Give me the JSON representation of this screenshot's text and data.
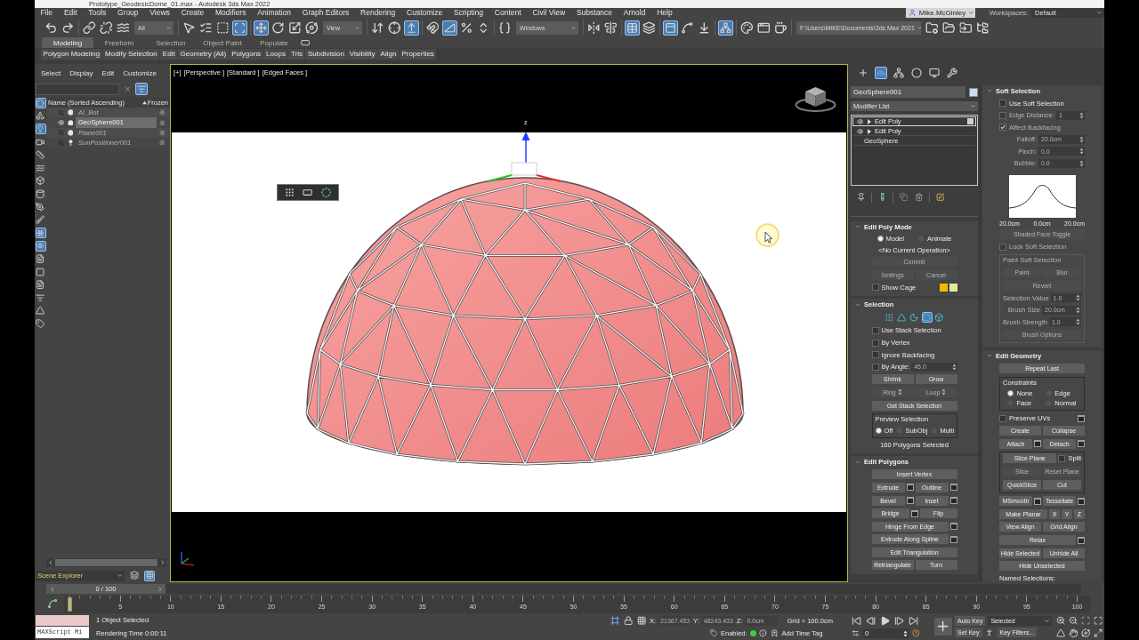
{
  "window": {
    "title": "Prototype_GeodesicDome_01.max - Autodesk 3ds Max 2022"
  },
  "menu": [
    "File",
    "Edit",
    "Tools",
    "Group",
    "Views",
    "Create",
    "Modifiers",
    "Animation",
    "Graph Editors",
    "Rendering",
    "Customize",
    "Scripting",
    "Content",
    "Civil View",
    "Substance",
    "Arnold",
    "Help"
  ],
  "user": {
    "name": "Mike.McGinley"
  },
  "workspaces": {
    "label": "Workspaces:",
    "value": "Default"
  },
  "main_toolbar": [
    {
      "items": [
        {
          "kind": "icon",
          "on": false
        },
        {
          "kind": "icon",
          "on": false
        }
      ]
    },
    {
      "items": [
        {
          "kind": "icon",
          "on": false
        },
        {
          "kind": "icon",
          "on": false
        },
        {
          "kind": "icon",
          "on": false
        },
        {
          "kind": "dropdown",
          "value": "All"
        }
      ]
    },
    {
      "items": [
        {
          "kind": "icon",
          "on": false
        },
        {
          "kind": "icon",
          "on": false
        },
        {
          "kind": "icon",
          "on": false
        },
        {
          "kind": "icon",
          "on": true
        }
      ]
    },
    {
      "items": [
        {
          "kind": "icon",
          "on": true
        },
        {
          "kind": "icon",
          "on": false
        },
        {
          "kind": "icon",
          "on": false
        },
        {
          "kind": "icon",
          "on": false
        },
        {
          "kind": "dropdown",
          "value": "View"
        }
      ]
    },
    {
      "items": [
        {
          "kind": "icon",
          "on": false
        },
        {
          "kind": "icon",
          "on": false
        },
        {
          "kind": "icon",
          "on": true
        }
      ]
    },
    {
      "items": [
        {
          "kind": "icon",
          "on": false
        },
        {
          "kind": "icon",
          "on": true
        },
        {
          "kind": "icon",
          "on": false
        },
        {
          "kind": "icon",
          "on": false
        }
      ]
    },
    {
      "items": [
        {
          "kind": "icon",
          "on": false
        },
        {
          "kind": "dropdown",
          "value": "Windows"
        }
      ]
    },
    {
      "items": [
        {
          "kind": "icon",
          "on": false
        },
        {
          "kind": "icon",
          "on": false
        }
      ]
    },
    {
      "items": [
        {
          "kind": "icon",
          "on": true
        },
        {
          "kind": "icon",
          "on": false
        }
      ]
    },
    {
      "items": [
        {
          "kind": "icon",
          "on": true
        },
        {
          "kind": "icon",
          "on": false
        },
        {
          "kind": "icon",
          "on": false
        }
      ]
    },
    {
      "items": [
        {
          "kind": "icon",
          "on": true
        }
      ]
    },
    {
      "items": [
        {
          "kind": "icon",
          "on": false
        },
        {
          "kind": "icon",
          "on": false
        },
        {
          "kind": "icon",
          "on": false
        }
      ]
    },
    {
      "items": [
        {
          "kind": "dropdown",
          "value": "F:\\Users\\MIKE\\Documents\\3ds Max 2021"
        },
        {
          "kind": "icon",
          "on": false
        },
        {
          "kind": "icon",
          "on": false
        },
        {
          "kind": "icon",
          "on": false
        },
        {
          "kind": "icon",
          "on": false
        }
      ]
    }
  ],
  "ribbon": {
    "tabs": [
      {
        "label": "Modeling",
        "selected": true
      },
      {
        "label": "Freeform",
        "selected": false
      },
      {
        "label": "Selection",
        "selected": false
      },
      {
        "label": "Object Paint",
        "selected": false
      },
      {
        "label": "Populate",
        "selected": false
      }
    ],
    "panels": [
      "Polygon Modeling",
      "Modify Selection",
      "Edit",
      "Geometry (All)",
      "Polygons",
      "Loops",
      "Tris",
      "Subdivision",
      "Visibility",
      "Align",
      "Properties"
    ]
  },
  "scene_explorer": {
    "menu": [
      "Select",
      "Display",
      "Edit",
      "Customize"
    ],
    "filter_on": true,
    "filters": [
      {
        "on": true
      },
      {
        "on": false
      },
      {
        "on": true
      },
      {
        "on": false
      },
      {
        "on": false
      },
      {
        "on": false
      },
      {
        "on": false
      },
      {
        "on": false
      },
      {
        "on": false
      },
      {
        "on": false
      },
      {
        "on": true
      },
      {
        "on": true
      },
      {
        "on": false
      },
      {
        "on": false
      },
      {
        "on": false
      },
      {
        "on": false
      },
      {
        "on": false
      },
      {
        "on": false
      }
    ],
    "columns": [
      "Name (Sorted Ascending)",
      "Frozen"
    ],
    "rows": [
      {
        "name": "AI_Bot",
        "kind": "geometry",
        "hidden": true,
        "selected": false
      },
      {
        "name": "GeoSphere001",
        "kind": "geometry",
        "hidden": false,
        "selected": true
      },
      {
        "name": "Plane001",
        "kind": "geometry",
        "hidden": true,
        "selected": false
      },
      {
        "name": "SunPositioner001",
        "kind": "light",
        "hidden": true,
        "selected": false
      }
    ],
    "footer": {
      "label": "Scene Explorer",
      "toggles": [
        {
          "on": false
        },
        {
          "on": true
        }
      ]
    }
  },
  "viewport": {
    "labels": [
      "[+]",
      "[Perspective ]",
      "[Standard ]",
      "[Edged Faces ]"
    ],
    "gizmo_label": "z"
  },
  "command_panel": {
    "tabs": [
      {
        "selected": false
      },
      {
        "selected": true
      },
      {
        "selected": false
      },
      {
        "selected": false
      },
      {
        "selected": false
      },
      {
        "selected": false
      }
    ],
    "object_name": "GeoSphere001",
    "modifier_list": "Modifier List",
    "stack": [
      {
        "name": "Edit Poly",
        "kind": "modifier",
        "expanded": false,
        "selected": true
      },
      {
        "name": "Edit Poly",
        "kind": "modifier",
        "expanded": false,
        "selected": false
      },
      {
        "name": "GeoSphere",
        "kind": "base",
        "expanded": false,
        "selected": false
      }
    ],
    "left_rollouts": [
      {
        "title": "Edit Poly Mode",
        "expanded": true,
        "items": [
          {
            "kind": "radios",
            "options": [
              {
                "label": "Model",
                "selected": true
              },
              {
                "label": "Animate",
                "selected": false
              }
            ]
          },
          {
            "kind": "text",
            "text": "<No Current Operation>"
          },
          {
            "kind": "row",
            "items": [
              {
                "kind": "button",
                "label": "Commit",
                "disabled": true
              }
            ]
          },
          {
            "kind": "row",
            "items": [
              {
                "kind": "button",
                "label": "Settings",
                "disabled": true
              },
              {
                "kind": "button",
                "label": "Cancel",
                "disabled": true
              }
            ]
          },
          {
            "kind": "row",
            "items": [
              {
                "kind": "checkbox",
                "label": "Show Cage",
                "checked": false,
                "disabled": false
              },
              {
                "kind": "swatch",
                "color": "#f5b800"
              },
              {
                "kind": "swatch",
                "color": "#e3eaa0"
              }
            ]
          }
        ]
      },
      {
        "title": "Selection",
        "expanded": true,
        "items": [
          {
            "kind": "icons",
            "options": [
              {
                "selected": false
              },
              {
                "selected": false
              },
              {
                "selected": false
              },
              {
                "selected": true
              },
              {
                "selected": false
              }
            ]
          },
          {
            "kind": "row",
            "items": [
              {
                "kind": "checkbox",
                "label": "Use Stack Selection",
                "checked": false,
                "disabled": false
              }
            ]
          },
          {
            "kind": "row",
            "items": [
              {
                "kind": "checkbox",
                "label": "By Vertex",
                "checked": false,
                "disabled": false
              }
            ]
          },
          {
            "kind": "row",
            "items": [
              {
                "kind": "checkbox",
                "label": "Ignore Backfacing",
                "checked": false,
                "disabled": false
              }
            ]
          },
          {
            "kind": "row",
            "items": [
              {
                "kind": "checkbox",
                "label": "By Angle:",
                "checked": false,
                "disabled": false
              },
              {
                "kind": "spinner",
                "value": "45.0",
                "disabled": true
              }
            ]
          },
          {
            "kind": "row",
            "items": [
              {
                "kind": "button",
                "label": "Shrink",
                "disabled": false
              },
              {
                "kind": "button",
                "label": "Grow",
                "disabled": false
              }
            ]
          },
          {
            "kind": "row",
            "items": [
              {
                "kind": "spin_button",
                "label": "Ring",
                "disabled": true
              },
              {
                "kind": "spin_button",
                "label": "Loop",
                "disabled": true
              }
            ]
          },
          {
            "kind": "row",
            "items": [
              {
                "kind": "button",
                "label": "Get Stack Selection",
                "disabled": false
              }
            ]
          },
          {
            "kind": "group",
            "title": "Preview Selection",
            "disabled": false,
            "items": [
              {
                "kind": "radios",
                "options": [
                  {
                    "label": "Off",
                    "selected": true
                  },
                  {
                    "label": "SubObj",
                    "selected": false
                  },
                  {
                    "label": "Multi",
                    "selected": false
                  }
                ]
              }
            ]
          },
          {
            "kind": "text",
            "text": "160 Polygons Selected"
          }
        ]
      },
      {
        "title": "Edit Polygons",
        "expanded": true,
        "items": [
          {
            "kind": "row",
            "items": [
              {
                "kind": "button",
                "label": "Insert Vertex",
                "disabled": false
              }
            ]
          },
          {
            "kind": "row",
            "items": [
              {
                "kind": "button",
                "label": "Extrude",
                "disabled": false
              },
              {
                "kind": "settings"
              },
              {
                "kind": "button",
                "label": "Outline",
                "disabled": false
              },
              {
                "kind": "settings"
              }
            ]
          },
          {
            "kind": "row",
            "items": [
              {
                "kind": "button",
                "label": "Bevel",
                "disabled": false
              },
              {
                "kind": "settings"
              },
              {
                "kind": "button",
                "label": "Inset",
                "disabled": false
              },
              {
                "kind": "settings"
              }
            ]
          },
          {
            "kind": "row",
            "items": [
              {
                "kind": "button",
                "label": "Bridge",
                "disabled": false
              },
              {
                "kind": "settings"
              },
              {
                "kind": "button",
                "label": "Flip",
                "disabled": false
              }
            ]
          },
          {
            "kind": "row",
            "items": [
              {
                "kind": "button",
                "label": "Hinge From Edge",
                "disabled": false
              },
              {
                "kind": "settings"
              }
            ]
          },
          {
            "kind": "row",
            "items": [
              {
                "kind": "button",
                "label": "Extrude Along Spline",
                "disabled": false
              },
              {
                "kind": "settings"
              }
            ]
          },
          {
            "kind": "row",
            "items": [
              {
                "kind": "button",
                "label": "Edit Triangulation",
                "disabled": false
              }
            ]
          },
          {
            "kind": "row",
            "items": [
              {
                "kind": "button",
                "label": "Retriangulate",
                "disabled": false
              },
              {
                "kind": "button",
                "label": "Turn",
                "disabled": false
              }
            ]
          }
        ]
      }
    ],
    "right_rollouts": [
      {
        "title": "Soft Selection",
        "expanded": true,
        "items": [
          {
            "kind": "row",
            "items": [
              {
                "kind": "checkbox",
                "label": "Use Soft Selection",
                "checked": false,
                "disabled": false
              }
            ]
          },
          {
            "kind": "row",
            "items": [
              {
                "kind": "checkbox",
                "label": "Edge Distance:",
                "checked": false,
                "disabled": true
              },
              {
                "kind": "spinner",
                "value": "1",
                "disabled": true
              }
            ]
          },
          {
            "kind": "row",
            "items": [
              {
                "kind": "checkbox",
                "label": "Affect Backfacing",
                "checked": true,
                "disabled": true
              }
            ]
          },
          {
            "kind": "row",
            "items": [
              {
                "kind": "spinner",
                "label": "Falloff:",
                "value": "20.0cm",
                "disabled": true
              }
            ]
          },
          {
            "kind": "row",
            "items": [
              {
                "kind": "spinner",
                "label": "Pinch:",
                "value": "0.0",
                "disabled": true
              }
            ]
          },
          {
            "kind": "row",
            "items": [
              {
                "kind": "spinner",
                "label": "Bubble:",
                "value": "0.0",
                "disabled": true
              }
            ]
          },
          {
            "kind": "curve",
            "labels": [
              "20.0cm",
              "0.0cm",
              "20.0cm"
            ]
          },
          {
            "kind": "row",
            "items": [
              {
                "kind": "button",
                "label": "Shaded Face Toggle",
                "disabled": true
              }
            ]
          },
          {
            "kind": "row",
            "items": [
              {
                "kind": "checkbox",
                "label": "Lock Soft Selection",
                "checked": false,
                "disabled": true
              }
            ]
          },
          {
            "kind": "group",
            "title": "Paint Soft Selection",
            "disabled": true,
            "items": [
              {
                "kind": "row",
                "items": [
                  {
                    "kind": "button",
                    "label": "Paint",
                    "disabled": true
                  },
                  {
                    "kind": "button",
                    "label": "Blur",
                    "disabled": true
                  }
                ]
              },
              {
                "kind": "row",
                "items": [
                  {
                    "kind": "button",
                    "label": "Revert",
                    "disabled": true
                  }
                ]
              },
              {
                "kind": "row",
                "items": [
                  {
                    "kind": "spinner",
                    "label": "Selection Value",
                    "value": "1.0",
                    "disabled": true
                  }
                ]
              },
              {
                "kind": "row",
                "items": [
                  {
                    "kind": "spinner",
                    "label": "Brush Size",
                    "value": "20.0cm",
                    "disabled": true
                  }
                ]
              },
              {
                "kind": "row",
                "items": [
                  {
                    "kind": "spinner",
                    "label": "Brush Strength",
                    "value": "1.0",
                    "disabled": true
                  }
                ]
              },
              {
                "kind": "row",
                "items": [
                  {
                    "kind": "button",
                    "label": "Brush Options",
                    "disabled": true
                  }
                ]
              }
            ]
          }
        ]
      },
      {
        "title": "Edit Geometry",
        "expanded": true,
        "items": [
          {
            "kind": "row",
            "items": [
              {
                "kind": "button",
                "label": "Repeat Last",
                "disabled": false
              }
            ]
          },
          {
            "kind": "group",
            "title": "Constraints",
            "disabled": false,
            "items": [
              {
                "kind": "radios",
                "options": [
                  {
                    "label": "None",
                    "selected": true
                  },
                  {
                    "label": "Edge",
                    "selected": false
                  },
                  {
                    "label": "Face",
                    "selected": false
                  },
                  {
                    "label": "Normal",
                    "selected": false
                  }
                ]
              }
            ]
          },
          {
            "kind": "row",
            "items": [
              {
                "kind": "checkbox",
                "label": "Preserve UVs",
                "checked": false,
                "disabled": false
              },
              {
                "kind": "settings"
              }
            ]
          },
          {
            "kind": "row",
            "items": [
              {
                "kind": "button",
                "label": "Create",
                "disabled": false
              },
              {
                "kind": "button",
                "label": "Collapse",
                "disabled": false
              }
            ]
          },
          {
            "kind": "row",
            "items": [
              {
                "kind": "button",
                "label": "Attach",
                "disabled": false
              },
              {
                "kind": "settings"
              },
              {
                "kind": "button",
                "label": "Detach",
                "disabled": false
              },
              {
                "kind": "settings"
              }
            ]
          },
          {
            "kind": "group",
            "disabled": false,
            "items": [
              {
                "kind": "row",
                "items": [
                  {
                    "kind": "button",
                    "label": "Slice Plane",
                    "disabled": false
                  },
                  {
                    "kind": "checkbox",
                    "label": "Split",
                    "checked": false,
                    "disabled": false
                  }
                ]
              },
              {
                "kind": "row",
                "items": [
                  {
                    "kind": "button",
                    "label": "Slice",
                    "disabled": true
                  },
                  {
                    "kind": "button",
                    "label": "Reset Plane",
                    "disabled": true
                  }
                ]
              },
              {
                "kind": "row",
                "items": [
                  {
                    "kind": "button",
                    "label": "QuickSlice",
                    "disabled": false
                  },
                  {
                    "kind": "button",
                    "label": "Cut",
                    "disabled": false
                  }
                ]
              }
            ]
          },
          {
            "kind": "row",
            "items": [
              {
                "kind": "button",
                "label": "MSmooth",
                "disabled": false
              },
              {
                "kind": "settings"
              },
              {
                "kind": "button",
                "label": "Tessellate",
                "disabled": false
              },
              {
                "kind": "settings"
              }
            ]
          },
          {
            "kind": "row",
            "items": [
              {
                "kind": "button",
                "label": "Make Planar",
                "disabled": false
              },
              {
                "kind": "button",
                "label": "X",
                "disabled": false
              },
              {
                "kind": "button",
                "label": "Y",
                "disabled": false
              },
              {
                "kind": "button",
                "label": "Z",
                "disabled": false
              }
            ]
          },
          {
            "kind": "row",
            "items": [
              {
                "kind": "button",
                "label": "View Align",
                "disabled": false
              },
              {
                "kind": "button",
                "label": "Grid Align",
                "disabled": false
              }
            ]
          },
          {
            "kind": "row",
            "items": [
              {
                "kind": "button",
                "label": "Relax",
                "disabled": false
              },
              {
                "kind": "settings"
              }
            ]
          },
          {
            "kind": "row",
            "items": [
              {
                "kind": "button",
                "label": "Hide Selected",
                "disabled": false
              },
              {
                "kind": "button",
                "label": "Unhide All",
                "disabled": false
              }
            ]
          },
          {
            "kind": "row",
            "items": [
              {
                "kind": "button",
                "label": "Hide Unselected",
                "disabled": false
              }
            ]
          },
          {
            "kind": "heading",
            "text": "Named Selections:"
          }
        ]
      }
    ]
  },
  "timeline": {
    "slider": {
      "label": "0 / 100",
      "level": 0
    },
    "ticks": [
      "5",
      "10",
      "15",
      "20",
      "25",
      "30",
      "35",
      "40",
      "45",
      "50",
      "55",
      "60",
      "65",
      "70",
      "75",
      "80",
      "85",
      "90",
      "95",
      "100"
    ]
  },
  "status": {
    "listener": "MAXScript Mi",
    "selection": "1 Object Selected",
    "render_time": "Rendering Time 0:00:11",
    "coords": [
      {
        "axis": "X:",
        "value": "21367.453",
        "disabled": true
      },
      {
        "axis": "Y:",
        "value": "48243.433",
        "disabled": true
      },
      {
        "axis": "Z:",
        "value": "0.0cm",
        "disabled": true
      }
    ],
    "grid": "Grid = 100.0cm",
    "time_tag": {
      "label": "Enabled:",
      "enabled": true,
      "button": "Add Time Tag"
    },
    "frame": "0",
    "auto_key": "Auto Key",
    "key_mode": "Selected",
    "set_key": "Set Key",
    "key_filters": "Key Filters..."
  }
}
